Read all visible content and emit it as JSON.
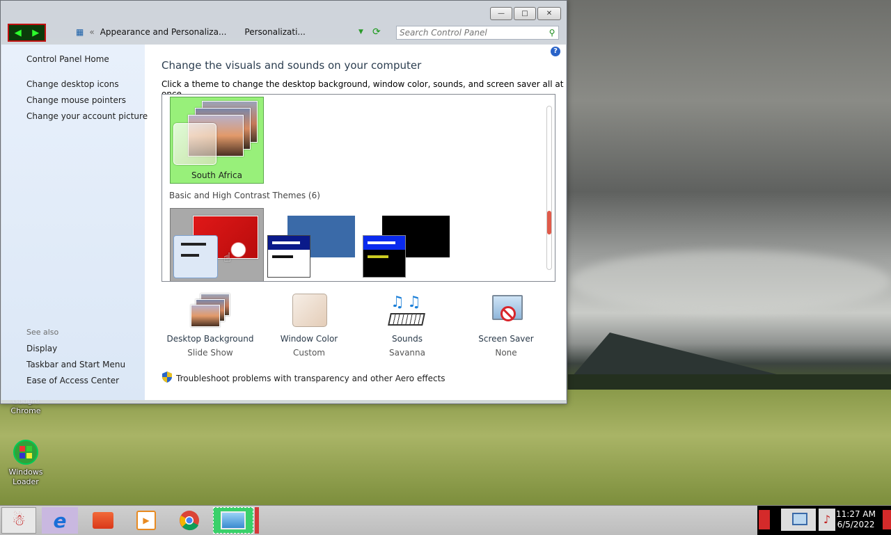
{
  "window": {
    "breadcrumbs": [
      "Appearance and Personaliza...",
      "Personalizati..."
    ],
    "search_placeholder": "Search Control Panel"
  },
  "sidebar": {
    "home": "Control Panel Home",
    "links": [
      "Change desktop icons",
      "Change mouse pointers",
      "Change your account picture"
    ],
    "see_also_label": "See also",
    "see_also": [
      "Display",
      "Taskbar and Start Menu",
      "Ease of Access Center"
    ]
  },
  "main": {
    "title": "Change the visuals and sounds on your computer",
    "subtitle": "Click a theme to change the desktop background, window color, sounds, and screen saver all at once.",
    "selected_theme": "South Africa",
    "basic_section": "Basic and High Contrast Themes (6)",
    "scroll_position": 0.75
  },
  "options": [
    {
      "name": "Desktop Background",
      "value": "Slide Show",
      "icon": "desktop-background-icon"
    },
    {
      "name": "Window Color",
      "value": "Custom",
      "icon": "window-color-icon"
    },
    {
      "name": "Sounds",
      "value": "Savanna",
      "icon": "sounds-icon"
    },
    {
      "name": "Screen Saver",
      "value": "None",
      "icon": "screen-saver-icon"
    }
  ],
  "troubleshoot": "Troubleshoot problems with transparency and other Aero effects",
  "desktop_icons": [
    {
      "label": "Google\nChrome"
    },
    {
      "label": "Windows\nLoader"
    }
  ],
  "taskbar": {
    "clock_time": "11:27 AM",
    "clock_date": "6/5/2022"
  },
  "colors": {
    "selected_theme_bg": "#98f07a",
    "link": "#1e1e1e",
    "title": "#2c3e50"
  }
}
